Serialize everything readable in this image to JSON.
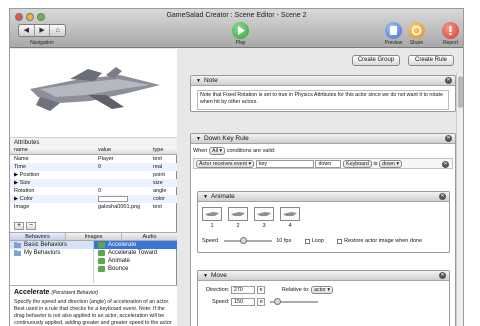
{
  "window": {
    "title": "GameSalad Creator : Scene Editor - Scene 2"
  },
  "toolbar": {
    "nav_back": "◀",
    "nav_forward": "▶",
    "nav_home": "⌂",
    "navigation_label": "Navigation",
    "play_label": "Play",
    "preview_label": "Preview",
    "share_label": "Share",
    "report_label": "Report"
  },
  "attributes": {
    "heading": "Attributes",
    "columns": [
      "name",
      "value",
      "type"
    ],
    "rows": [
      {
        "name": "Name",
        "value": "Player",
        "type": "text"
      },
      {
        "name": "Time",
        "value": "0",
        "type": "real"
      },
      {
        "name": "▶ Position",
        "value": "",
        "type": "point"
      },
      {
        "name": "▶ Size",
        "value": "",
        "type": "size"
      },
      {
        "name": "Rotation",
        "value": "0",
        "type": "angle"
      },
      {
        "name": "▶ Color",
        "value": "",
        "type": "color"
      },
      {
        "name": "Image",
        "value": "galosha0001.png",
        "type": "text"
      }
    ]
  },
  "plus_label": "+",
  "minus_label": "−",
  "tabs": [
    "Behaviors",
    "Images",
    "Audio"
  ],
  "behavior_groups": [
    "Basic Behaviors",
    "My Behaviors"
  ],
  "behavior_items": [
    "Accelerate",
    "Accelerate Toward",
    "Animate",
    "Bounce"
  ],
  "description": {
    "title": "Accelerate",
    "subtitle": "(Persistent Behavior)",
    "body": "Specify the speed and direction (angle) of acceleration of an actor. Best used in a rule that checks for a keyboard event. Note: If the drag behavior is not also applied to an actor, acceleration will be continuously applied, adding greater and greater speed to the actor until it has reached"
  },
  "buttons": {
    "create_group": "Create Group",
    "create_rule": "Create Rule"
  },
  "note": {
    "title": "Note",
    "text": "Note that Fixed Rotation is set to true in Physics Attributes for this actor since we do not want it to rotate when hit by other actors."
  },
  "rule": {
    "title": "Down Key Rule",
    "when_label": "When",
    "all_value": "All",
    "conditions_label": "conditions are valid:",
    "cond_event": "Actor receives event",
    "cond_key": "key",
    "cond_down": "down",
    "keyboard_button": "Keyboard",
    "is_label": "is",
    "is_value": "down"
  },
  "animate": {
    "title": "Animate",
    "frames": [
      "1",
      "2",
      "3",
      "4"
    ],
    "speed_label": "Speed",
    "speed_value": "10 fps",
    "loop_label": "Loop",
    "restore_label": "Restore actor image when done"
  },
  "move": {
    "title": "Move",
    "direction_label": "Direction:",
    "direction_value": "270",
    "relative_label": "Relative to:",
    "relative_value": "actor",
    "speed_label": "Speed:",
    "speed_value": "150"
  },
  "colors": {
    "selection": "#3875d7",
    "play_green": "#2e9e36",
    "report_red": "#d23a2a",
    "preview_blue": "#3a6fc9"
  }
}
